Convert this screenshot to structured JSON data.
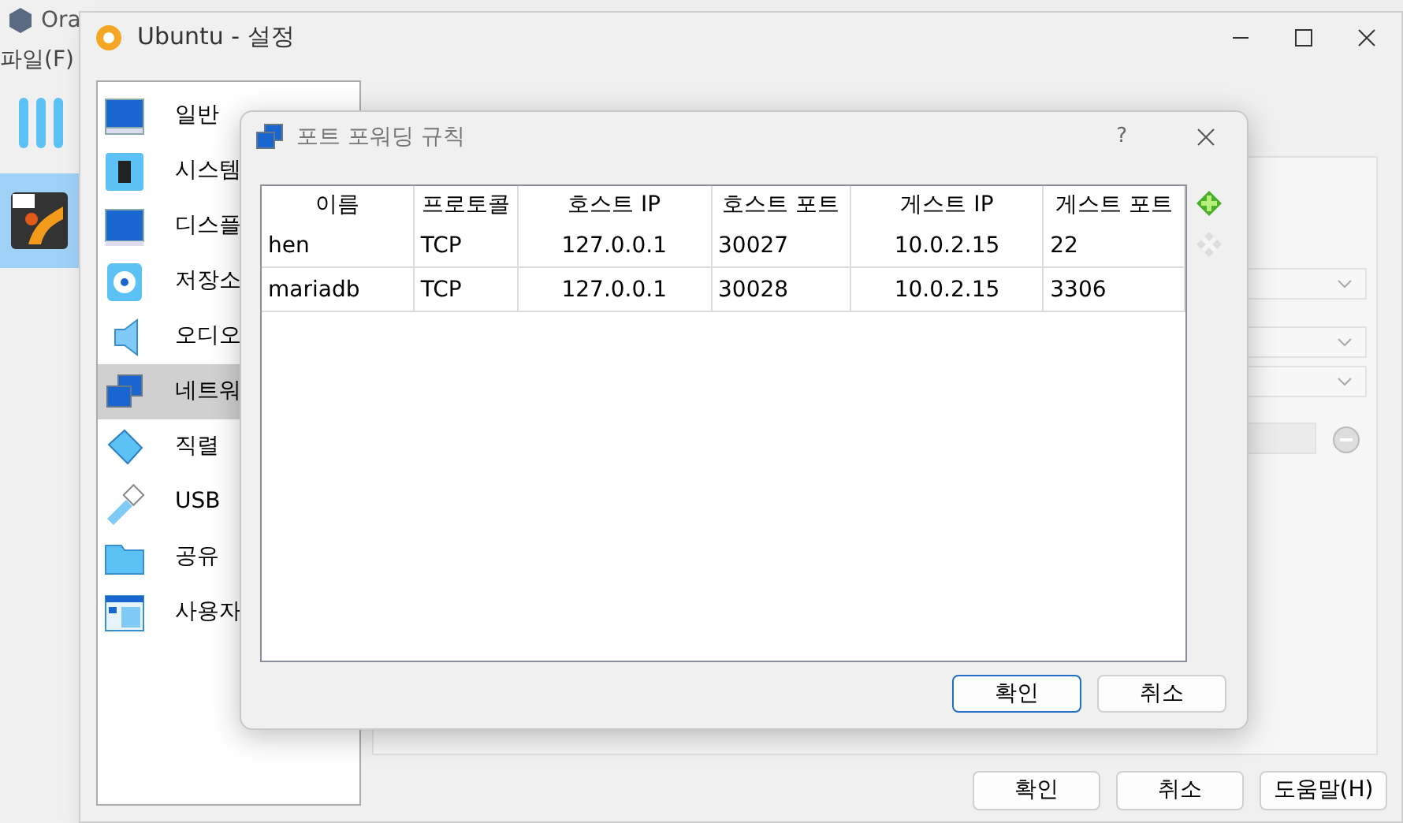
{
  "main_window": {
    "title": "Ora",
    "menu": [
      "파일(F)"
    ],
    "vm_list": [
      {
        "selected": true
      }
    ]
  },
  "settings_window": {
    "title": "Ubuntu - 설정",
    "sidebar": {
      "items": [
        {
          "label": "일반",
          "selected": false
        },
        {
          "label": "시스템",
          "selected": false
        },
        {
          "label": "디스플",
          "selected": false
        },
        {
          "label": "저장소",
          "selected": false
        },
        {
          "label": "오디오",
          "selected": false
        },
        {
          "label": "네트워",
          "selected": true
        },
        {
          "label": "직렬",
          "selected": false
        },
        {
          "label": "USB",
          "selected": false
        },
        {
          "label": "공유",
          "selected": false
        },
        {
          "label": "사용자",
          "selected": false
        }
      ]
    },
    "buttons": [
      "확인",
      "취소",
      "도움말(H)"
    ]
  },
  "dialog": {
    "title": "포트 포워딩 규칙",
    "help": "?",
    "table": {
      "columns": [
        "이름",
        "프로토콜",
        "호스트 IP",
        "호스트 포트",
        "게스트 IP",
        "게스트 포트"
      ],
      "rows": [
        [
          "hen",
          "TCP",
          "127.0.0.1",
          "30027",
          "10.0.2.15",
          "22"
        ],
        [
          "mariadb",
          "TCP",
          "127.0.0.1",
          "30028",
          "10.0.2.15",
          "3306"
        ]
      ]
    },
    "buttons": [
      {
        "label": "확인",
        "selected": true
      },
      {
        "label": "취소",
        "selected": false
      }
    ]
  }
}
